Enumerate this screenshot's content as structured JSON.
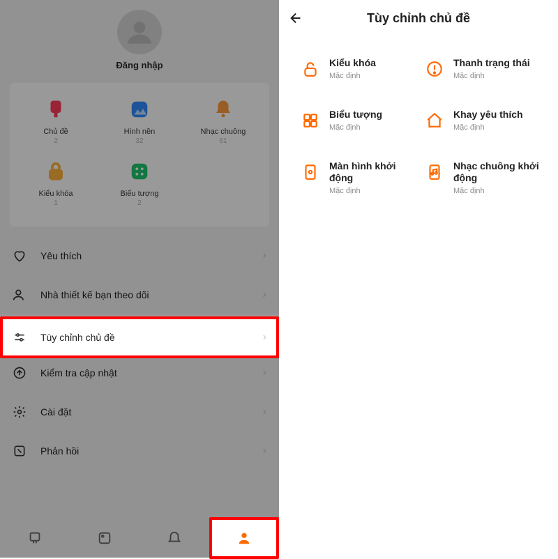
{
  "left": {
    "signin": "Đăng nhập",
    "dash": [
      {
        "label": "Chủ đề",
        "count": "2",
        "icon": "theme-icon",
        "color": "#ff5a5a"
      },
      {
        "label": "Hình nền",
        "count": "32",
        "icon": "wallpaper-icon",
        "color": "#2f8bff"
      },
      {
        "label": "Nhạc chuông",
        "count": "61",
        "icon": "ringtone-icon",
        "color": "#ff9a3d"
      },
      {
        "label": "Kiểu khóa",
        "count": "1",
        "icon": "lock-icon",
        "color": "#ffb23d"
      },
      {
        "label": "Biểu tượng",
        "count": "2",
        "icon": "icons-icon",
        "color": "#1ec76b"
      }
    ],
    "menu": [
      {
        "icon": "heart-icon",
        "label": "Yêu thích"
      },
      {
        "icon": "person-icon",
        "label": "Nhà thiết kế bạn theo dõi"
      },
      {
        "icon": "sliders-icon",
        "label": "Tùy chỉnh chủ đề"
      },
      {
        "icon": "update-icon",
        "label": "Kiểm tra cập nhật"
      },
      {
        "icon": "gear-icon",
        "label": "Cài đặt"
      },
      {
        "icon": "feedback-icon",
        "label": "Phản hồi"
      }
    ]
  },
  "right": {
    "title": "Tùy chỉnh chủ đề",
    "default_label": "Mặc định",
    "items": [
      {
        "icon": "lock-icon",
        "label": "Kiểu khóa"
      },
      {
        "icon": "status-icon",
        "label": "Thanh trạng thái"
      },
      {
        "icon": "grid-icon",
        "label": "Biểu tượng"
      },
      {
        "icon": "home-icon",
        "label": "Khay yêu thích"
      },
      {
        "icon": "boot-icon",
        "label": "Màn hình khởi động"
      },
      {
        "icon": "ringboot-icon",
        "label": "Nhạc chuông khởi động"
      }
    ]
  }
}
